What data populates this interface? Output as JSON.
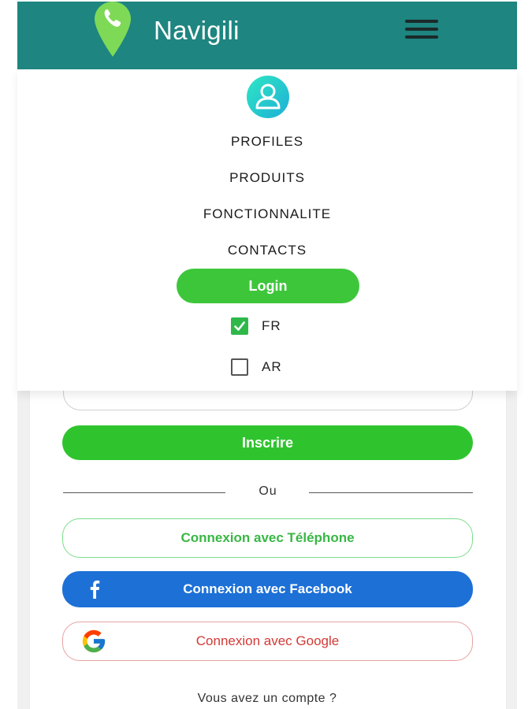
{
  "header": {
    "brand": "Navigili",
    "logo_icon": "phone-location-pin-icon",
    "menu_icon": "hamburger-menu-icon",
    "color": "#1e8580"
  },
  "menu": {
    "avatar_icon": "user-avatar-icon",
    "items": [
      {
        "label": "PROFILES"
      },
      {
        "label": "PRODUITS"
      },
      {
        "label": "FONCTIONNALITE"
      },
      {
        "label": "CONTACTS"
      }
    ],
    "login_label": "Login",
    "languages": [
      {
        "label": "FR",
        "checked": true
      },
      {
        "label": "AR",
        "checked": false
      }
    ]
  },
  "form": {
    "inscrire_label": "Inscrire",
    "divider_text": "Ou",
    "phone_label": "Connexion avec Téléphone",
    "facebook_label": "Connexion avec Facebook",
    "google_label": "Connexion avec Google",
    "account_text": "Vous avez un compte ?"
  },
  "colors": {
    "green": "#2fc42e",
    "facebook_blue": "#1d70d6",
    "google_red": "#d23a36",
    "teal": "#1e8580"
  }
}
